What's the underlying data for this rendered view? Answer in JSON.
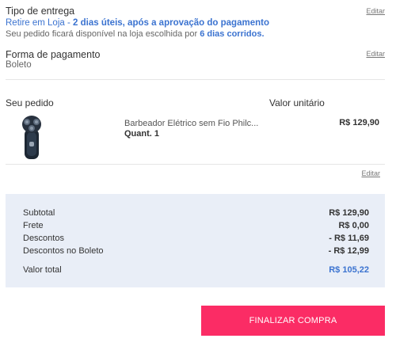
{
  "delivery": {
    "title": "Tipo de entrega",
    "edit_label": "Editar",
    "line1_a": "Retire em Loja - ",
    "line1_b": "2 dias úteis, após a aprovação do pagamento",
    "line2_a": "Seu pedido ficará disponível na loja escolhida por ",
    "line2_b": "6 dias corridos."
  },
  "payment": {
    "title": "Forma de pagamento",
    "edit_label": "Editar",
    "method": "Boleto"
  },
  "order": {
    "header_item": "Seu pedido",
    "header_price": "Valor unitário",
    "product_name": "Barbeador Elétrico sem Fio Philc...",
    "quantity": "Quant. 1",
    "unit_price": "R$ 129,90",
    "edit_label": "Editar"
  },
  "summary": {
    "rows": [
      {
        "label": "Subtotal",
        "value": "R$ 129,90"
      },
      {
        "label": "Frete",
        "value": "R$ 0,00"
      },
      {
        "label": "Descontos",
        "value": "- R$ 11,69"
      },
      {
        "label": "Descontos no Boleto",
        "value": "- R$ 12,99"
      }
    ],
    "total_label": "Valor total",
    "total_value": "R$ 105,22"
  },
  "finalize_label": "FINALIZAR COMPRA",
  "colors": {
    "accent_blue": "#3b73d0",
    "cta_pink": "#fb2c65",
    "summary_bg": "#e9eef7"
  }
}
